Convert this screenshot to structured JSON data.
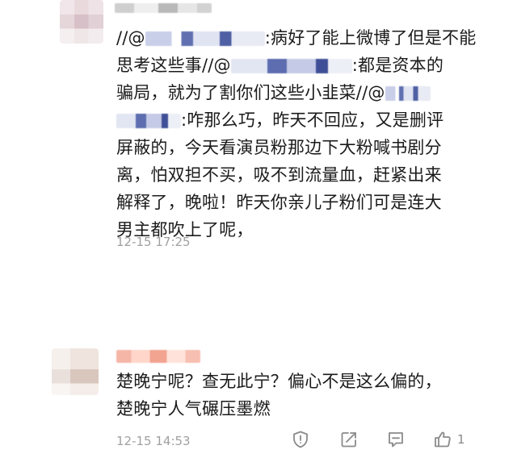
{
  "comments": [
    {
      "lines": [
        {
          "prefix": "//@",
          "suffix": ":病好了能上微博了但是不能"
        },
        {
          "prefix": "思考这些事//@",
          "suffix": ":都是资本的"
        },
        {
          "text": "骗局，就为了割你们这些小韭菜//@"
        },
        {
          "suffix": ":咋那么巧，昨天不回应，又是删评"
        },
        {
          "text": "屏蔽的，今天看演员粉那边下大粉喊书剧分"
        },
        {
          "text": "离，怕双担不买，吸不到流量血，赶紧出来"
        },
        {
          "text": "解释了，晚啦！昨天你亲儿子粉们可是连大"
        },
        {
          "text": "男主都吹上了呢，"
        }
      ],
      "timestamp": "12-15 17:25"
    },
    {
      "lines": [
        {
          "text": "楚晚宁呢？查无此宁？偏心不是这么偏的，"
        },
        {
          "text": "楚晚宁人气碾压墨燃"
        }
      ],
      "timestamp": "12-15 14:53",
      "like_count": "1"
    }
  ],
  "colors": {
    "text": "#1b1b1b",
    "meta": "#a0a0a0",
    "icon": "#8a8a8a"
  }
}
